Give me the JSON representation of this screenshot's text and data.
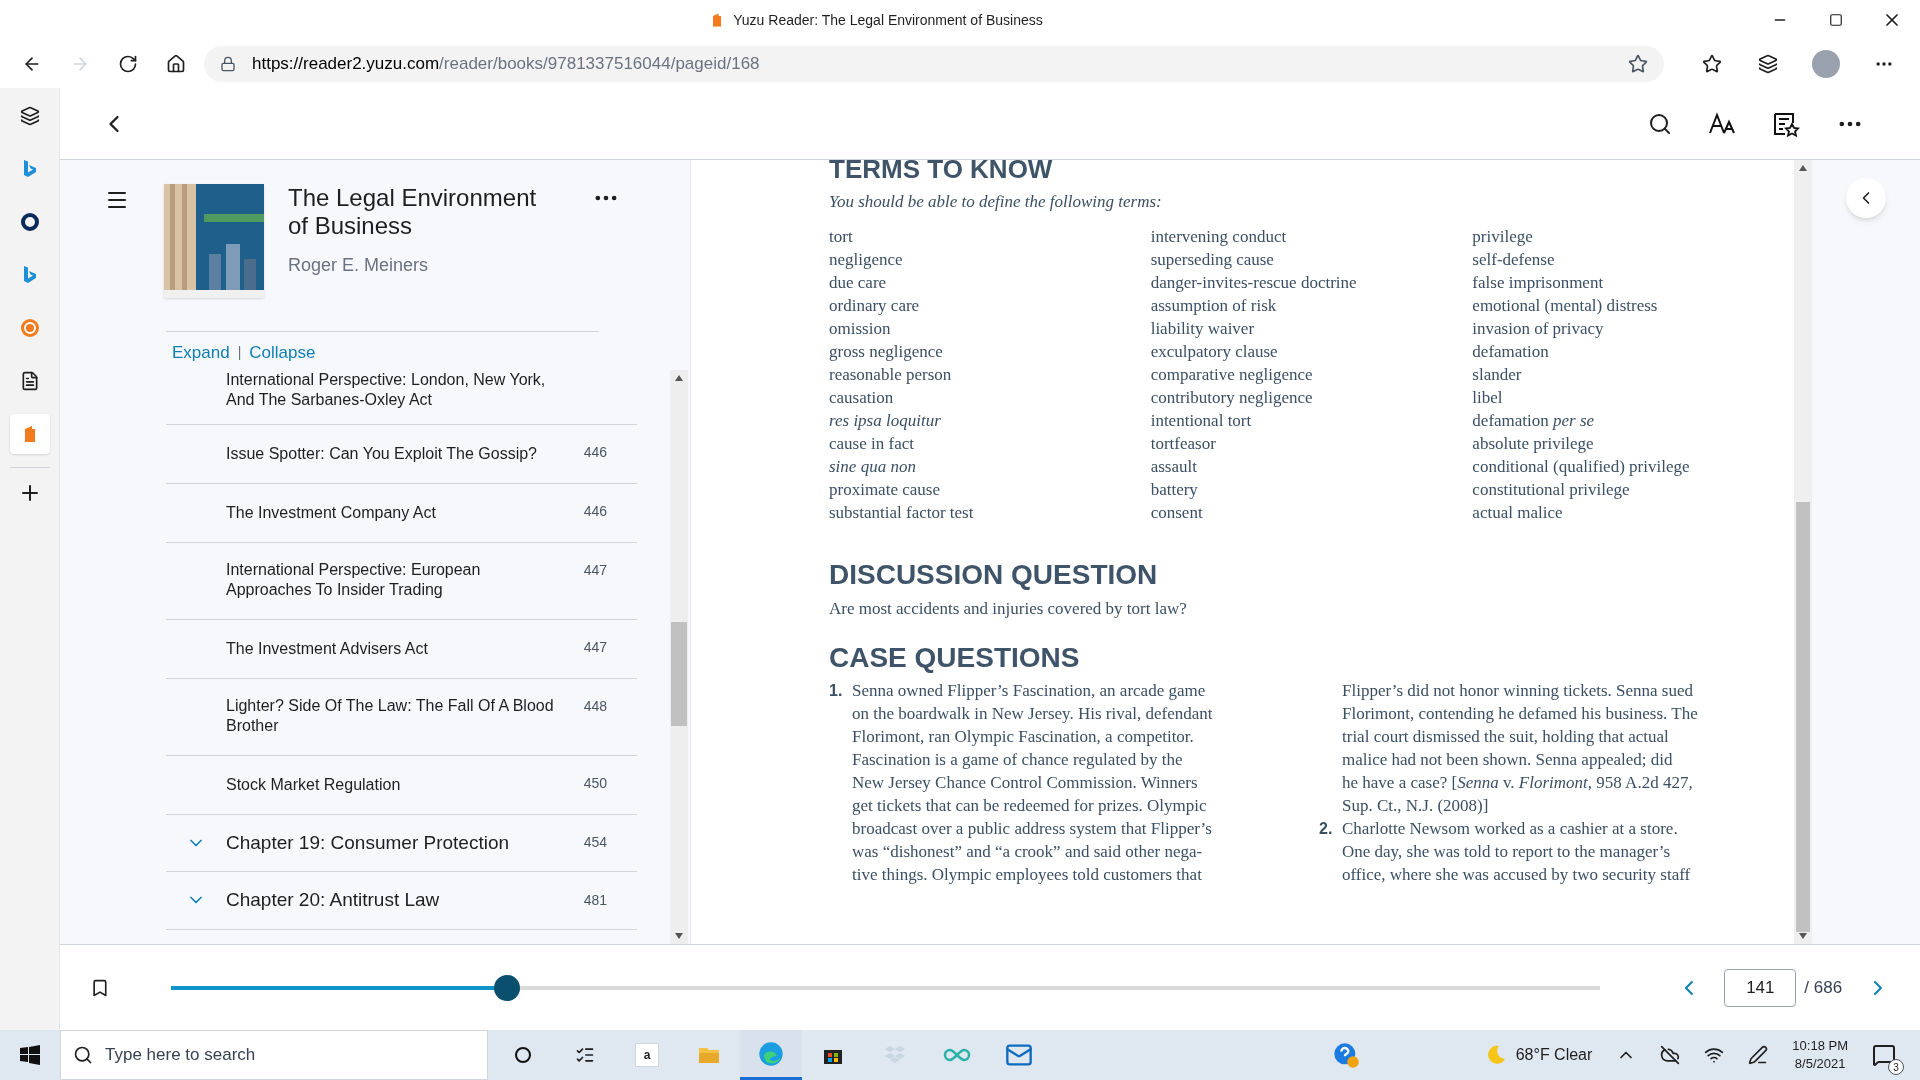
{
  "window": {
    "title": "Yuzu Reader: The Legal Environment of Business"
  },
  "address_bar": {
    "url_host": "https://reader2.yuzu.com",
    "url_path": "/reader/books/9781337516044/pageid/168"
  },
  "edge_sidebar": {
    "items": [
      {
        "kind": "tabs",
        "selected": false
      },
      {
        "kind": "bing",
        "selected": false
      },
      {
        "kind": "ring",
        "selected": false
      },
      {
        "kind": "bing",
        "selected": false
      },
      {
        "kind": "badge",
        "selected": false
      },
      {
        "kind": "document",
        "selected": false
      },
      {
        "kind": "yuzu",
        "selected": true
      }
    ]
  },
  "book": {
    "title": "The Legal Environment of Business",
    "author": "Roger E. Meiners"
  },
  "toc_controls": {
    "expand": "Expand",
    "separator": "|",
    "collapse": "Collapse"
  },
  "toc": [
    {
      "kind": "section",
      "label": "International Perspective: London, New York, And The Sarbanes-Oxley Act"
    },
    {
      "kind": "section",
      "label": "Issue Spotter: Can You Exploit The Gossip?",
      "page": "446"
    },
    {
      "kind": "section",
      "label": "The Investment Company Act",
      "page": "446"
    },
    {
      "kind": "section",
      "label": "International Perspective: European Approaches To Insider Trading",
      "page": "447"
    },
    {
      "kind": "section",
      "label": "The Investment Advisers Act",
      "page": "447"
    },
    {
      "kind": "section",
      "label": "Lighter? Side Of The Law: The Fall Of A Blood Brother",
      "page": "448"
    },
    {
      "kind": "section",
      "label": "Stock Market Regulation",
      "page": "450"
    },
    {
      "kind": "chapter",
      "label": "Chapter 19: Consumer Protection",
      "page": "454",
      "expanded": false
    },
    {
      "kind": "chapter",
      "label": "Chapter 20: Antitrust Law",
      "page": "481",
      "expanded": false
    }
  ],
  "page": {
    "terms_heading": "TERMS TO KNOW",
    "terms_intro": "You should be able to define the following terms:",
    "terms": [
      [
        {
          "text": "tort",
          "italic": false
        },
        {
          "text": "negligence",
          "italic": false
        },
        {
          "text": "due care",
          "italic": false
        },
        {
          "text": "ordinary care",
          "italic": false
        },
        {
          "text": "omission",
          "italic": false
        },
        {
          "text": "gross negligence",
          "italic": false
        },
        {
          "text": "reasonable person",
          "italic": false
        },
        {
          "text": "causation",
          "italic": false
        },
        {
          "text": "res ipsa loquitur",
          "italic": true
        },
        {
          "text": "cause in fact",
          "italic": false
        },
        {
          "text": "sine qua non",
          "italic": true
        },
        {
          "text": "proximate cause",
          "italic": false
        },
        {
          "text": "substantial factor test",
          "italic": false
        }
      ],
      [
        {
          "text": "intervening conduct",
          "italic": false
        },
        {
          "text": "superseding cause",
          "italic": false
        },
        {
          "text": "danger-invites-rescue doctrine",
          "italic": false
        },
        {
          "text": "assumption of risk",
          "italic": false
        },
        {
          "text": "liability waiver",
          "italic": false
        },
        {
          "text": "exculpatory clause",
          "italic": false
        },
        {
          "text": "comparative negligence",
          "italic": false
        },
        {
          "text": "contributory negligence",
          "italic": false
        },
        {
          "text": "intentional tort",
          "italic": false
        },
        {
          "text": "tortfeasor",
          "italic": false
        },
        {
          "text": "assault",
          "italic": false
        },
        {
          "text": "battery",
          "italic": false
        },
        {
          "text": "consent",
          "italic": false
        }
      ],
      [
        {
          "text": "privilege",
          "italic": false
        },
        {
          "text": "self-defense",
          "italic": false
        },
        {
          "text": "false imprisonment",
          "italic": false
        },
        {
          "text": "emotional (mental) distress",
          "italic": false
        },
        {
          "text": "invasion of privacy",
          "italic": false
        },
        {
          "text": "defamation",
          "italic": false
        },
        {
          "text": "slander",
          "italic": false
        },
        {
          "text": "libel",
          "italic": false
        },
        {
          "text": "defamation *per se*",
          "italic": false
        },
        {
          "text": "absolute privilege",
          "italic": false
        },
        {
          "text": "conditional (qualified) privilege",
          "italic": false
        },
        {
          "text": "constitutional privilege",
          "italic": false
        },
        {
          "text": "actual malice",
          "italic": false
        }
      ]
    ],
    "discussion_heading": "DISCUSSION QUESTION",
    "discussion_text": "Are most accidents and injuries covered by tort law?",
    "case_heading": "CASE QUESTIONS",
    "case_columns": [
      [
        {
          "number": "1.",
          "lines": [
            "Senna owned Flipper’s Fascination, an arcade game",
            "on the boardwalk in New Jersey. His rival, defendant",
            "Florimont, ran Olympic Fascination, a competitor.",
            "Fascination is a game of chance regulated by the",
            "New Jersey Chance Control Commission. Winners",
            "get tickets that can be redeemed for prizes. Olympic",
            "broadcast over a public address system that Flipper’s",
            "was “dishonest” and “a crook” and said other nega-",
            "tive things. Olympic employees told customers that"
          ]
        }
      ],
      [
        {
          "lines": [
            "Flipper’s did not honor winning tickets. Senna sued",
            "Florimont, contending he defamed his business. The",
            "trial court dismissed the suit, holding that actual",
            "malice had not been shown. Senna appealed; did",
            "he have a case? [*Senna* v. *Florimont*, 958 A.2d 427,",
            "Sup. Ct., N.J. (2008)]"
          ]
        },
        {
          "number": "2.",
          "lines": [
            "Charlotte Newsom worked as a cashier at a store.",
            "One day, she was told to report to the manager’s",
            "office, where she was accused by two security staff"
          ]
        }
      ]
    ]
  },
  "progress": {
    "level": 0.235,
    "current_page": "141",
    "total": "/ 686"
  },
  "taskbar": {
    "search_placeholder": "Type here to search",
    "amazon_letter": "a",
    "apps": [
      {
        "kind": "cortana",
        "selected": false
      },
      {
        "kind": "taskview",
        "selected": false
      },
      {
        "kind": "amazon",
        "selected": false
      },
      {
        "kind": "explorer",
        "selected": false
      },
      {
        "kind": "edge",
        "selected": true
      },
      {
        "kind": "store",
        "selected": false
      },
      {
        "kind": "dropbox",
        "selected": false
      },
      {
        "kind": "infinity",
        "selected": false
      },
      {
        "kind": "mail",
        "selected": false
      }
    ],
    "weather": "68°F Clear",
    "time": "10:18 PM",
    "date": "8/5/2021",
    "notifications": "3"
  }
}
